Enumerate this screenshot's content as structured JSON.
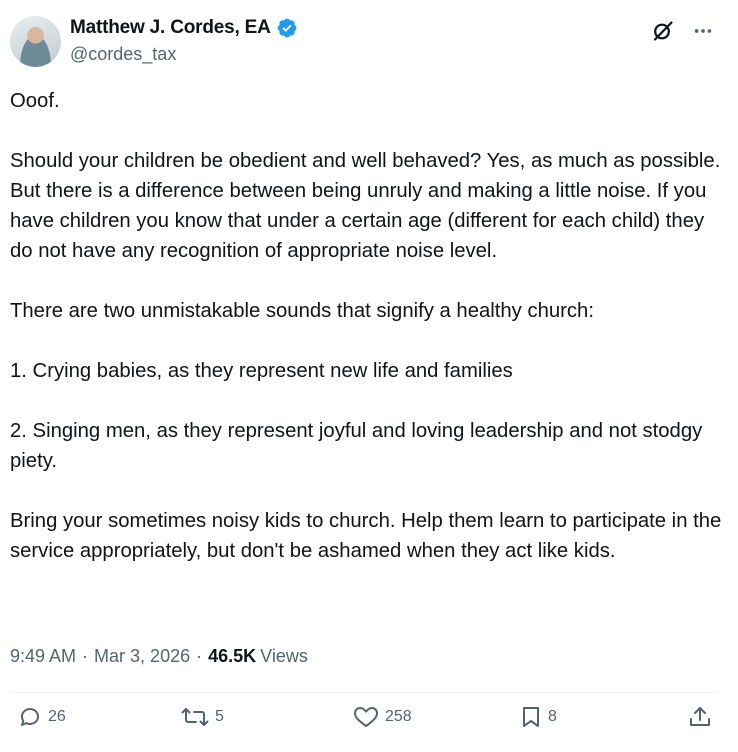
{
  "author": {
    "name": "Matthew J. Cordes, EA",
    "handle": "@cordes_tax",
    "verified_color": "#1d9bf0"
  },
  "icons": {
    "grok": "grok-slash-icon",
    "more": "more-dots-icon",
    "reply": "reply-bubble-icon",
    "repost": "repost-arrows-icon",
    "like": "heart-icon",
    "bookmark": "bookmark-icon",
    "share": "share-upload-icon"
  },
  "post": {
    "text": "Ooof.\n\nShould your children be obedient and well behaved? Yes, as much as possible. But there is a difference between being unruly and making a little noise. If you have children you know that under a certain age (different for each child) they do not have any recognition of appropriate noise level.\n\nThere are two unmistakable sounds that signify a healthy church:\n\n1. Crying babies, as they represent new life and families\n\n2. Singing men, as they represent joyful and loving leadership and not stodgy piety.\n\nBring your sometimes noisy kids to church. Help them learn to participate in the service appropriately, but don't be ashamed when they act like kids."
  },
  "meta": {
    "time": "9:49 AM",
    "separator": "·",
    "date": "Mar 3, 2026",
    "views_count": "46.5K",
    "views_label": "Views"
  },
  "actions": {
    "replies": "26",
    "reposts": "5",
    "likes": "258",
    "bookmarks": "8"
  }
}
